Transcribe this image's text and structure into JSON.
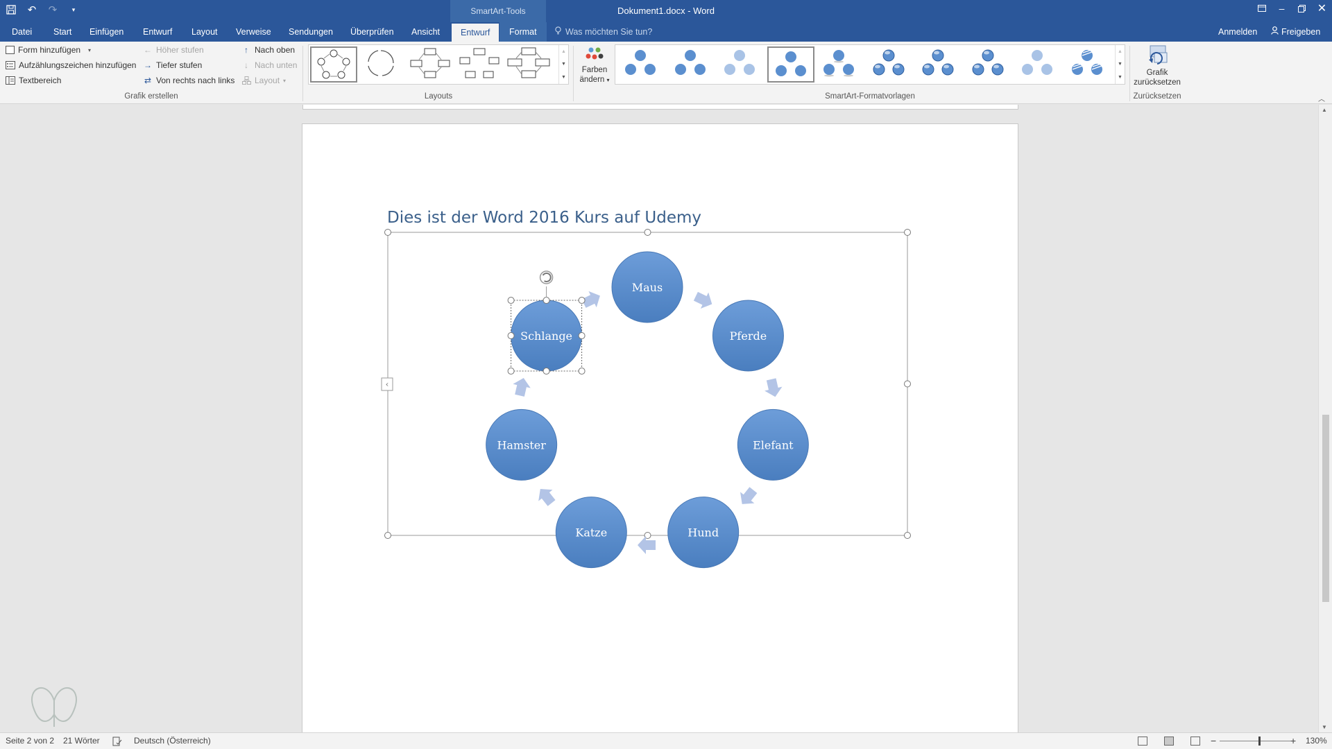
{
  "app": {
    "doc_title": "Dokument1.docx - Word",
    "contextual_group": "SmartArt-Tools"
  },
  "qat": {
    "save_icon": "save-icon",
    "undo_icon": "undo-icon",
    "redo_icon": "redo-icon",
    "customize_icon": "customize-qat-icon"
  },
  "tabs": [
    {
      "label": "Datei",
      "active": false
    },
    {
      "label": "Start",
      "active": false
    },
    {
      "label": "Einfügen",
      "active": false
    },
    {
      "label": "Entwurf",
      "active": false
    },
    {
      "label": "Layout",
      "active": false
    },
    {
      "label": "Verweise",
      "active": false
    },
    {
      "label": "Sendungen",
      "active": false
    },
    {
      "label": "Überprüfen",
      "active": false
    },
    {
      "label": "Ansicht",
      "active": false
    },
    {
      "label": "Entwurf",
      "active": true
    },
    {
      "label": "Format",
      "active": false
    }
  ],
  "tell_me": {
    "placeholder": "Was möchten Sie tun?"
  },
  "account": {
    "signin": "Anmelden",
    "share": "Freigeben"
  },
  "ribbon": {
    "grafik_erstellen": {
      "label": "Grafik erstellen",
      "add_shape": "Form hinzufügen",
      "add_bullet": "Aufzählungszeichen hinzufügen",
      "text_pane": "Textbereich",
      "promote": "Höher stufen",
      "demote": "Tiefer stufen",
      "right_to_left": "Von rechts nach links",
      "move_up": "Nach oben",
      "move_down": "Nach unten",
      "layout": "Layout"
    },
    "layouts": {
      "label": "Layouts",
      "selected_index": 0
    },
    "colors": {
      "line1": "Farben",
      "line2": "ändern"
    },
    "styles": {
      "label": "SmartArt-Formatvorlagen",
      "selected_index": 3
    },
    "reset": {
      "line1": "Grafik",
      "line2": "zurücksetzen",
      "label": "Zurücksetzen"
    }
  },
  "document": {
    "heading": "Dies ist der Word 2016 Kurs auf Udemy",
    "smartart": {
      "layout": "cycle",
      "selected_node": "Schlange",
      "fill_color": "#5b8fcf",
      "arrow_color": "#b3c4e6",
      "nodes": [
        "Maus",
        "Pferde",
        "Elefant",
        "Hund",
        "Katze",
        "Hamster",
        "Schlange"
      ]
    }
  },
  "status": {
    "page": "Seite 2 von 2",
    "words": "21 Wörter",
    "language": "Deutsch (Österreich)",
    "zoom": "130%",
    "zoom_minus": "−",
    "zoom_plus": "+"
  }
}
